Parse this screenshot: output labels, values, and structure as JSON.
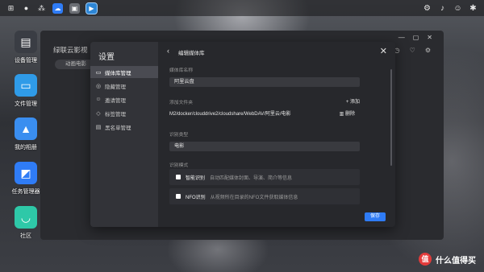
{
  "taskbar": {
    "left_icons": [
      "grid-icon",
      "user-icon",
      "apps-icon",
      "cloud-icon",
      "monitor-icon",
      "video-icon"
    ],
    "right_icons": [
      "settings-icon",
      "bell-icon",
      "user-icon",
      "gear-icon"
    ]
  },
  "desktop": {
    "icons": [
      {
        "label": "设备管理",
        "icon": "device-icon",
        "color": "#3a3d44"
      },
      {
        "label": "文件管理",
        "icon": "folder-icon",
        "color": "#2f9be8"
      },
      {
        "label": "我的相册",
        "icon": "photo-icon",
        "color": "#3a8ef0"
      },
      {
        "label": "任务管理器",
        "icon": "monitor-icon",
        "color": "#2f7cf6"
      },
      {
        "label": "社区",
        "icon": "community-icon",
        "color": "#2ec8a8"
      }
    ]
  },
  "app": {
    "title": "绿联云影视",
    "tab": "动画电影"
  },
  "settings": {
    "title": "设置",
    "menu": [
      {
        "label": "媒体库管理",
        "icon": "library-icon",
        "active": true
      },
      {
        "label": "隐藏管理",
        "icon": "hide-icon",
        "active": false
      },
      {
        "label": "邀请管理",
        "icon": "invite-icon",
        "active": false
      },
      {
        "label": "标签管理",
        "icon": "tag-icon",
        "active": false
      },
      {
        "label": "黑名单管理",
        "icon": "blacklist-icon",
        "active": false
      }
    ],
    "editor": {
      "title": "编辑媒体库",
      "name_label": "媒体库名称",
      "name_value": "阿里云盘",
      "folder_label": "添加文件夹",
      "add_label": "添加",
      "folder_path": "M2/docker/clouddrive2/cloudshare/WebDAV/阿里云/电影",
      "delete_label": "删除",
      "type_label": "识别类型",
      "type_value": "电影",
      "mode_label": "识别模式",
      "modes": [
        {
          "name": "智能识别",
          "desc": "自动匹配媒体封面、导演、简介等信息"
        },
        {
          "name": "NFO识别",
          "desc": "从视频所在目录的NFO文件获取媒体信息"
        }
      ],
      "save_label": "保存"
    }
  },
  "brand": {
    "logo": "值",
    "text": "什么值得买"
  },
  "colors": {
    "accent": "#2f7cf6"
  }
}
